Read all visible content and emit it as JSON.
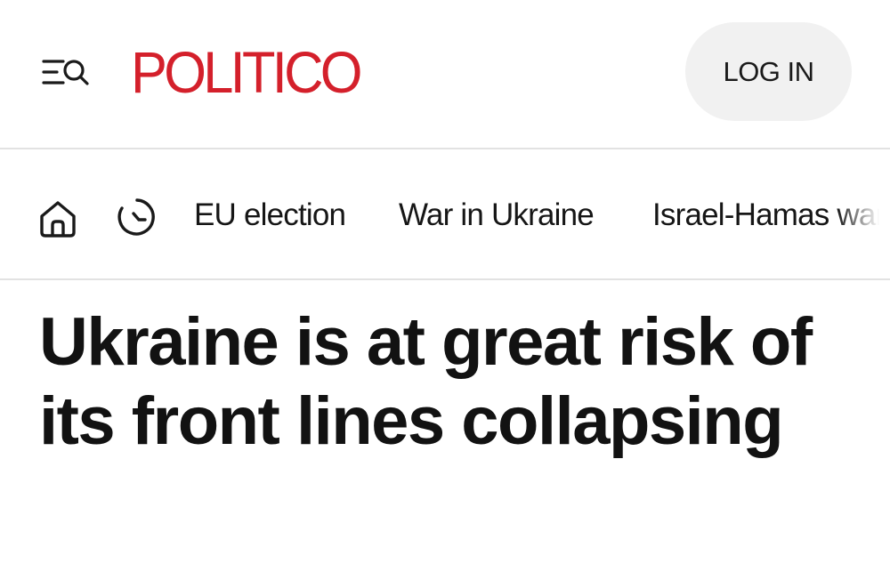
{
  "header": {
    "menu_search_icon": "menu-search-icon",
    "logo_text": "POLITICO",
    "logo_color": "#d4202b",
    "login_label": "LOG IN"
  },
  "nav": {
    "home_icon": "home-icon",
    "recent_icon": "clock-icon",
    "links": [
      {
        "label": "EU election"
      },
      {
        "label": "War in Ukraine"
      },
      {
        "label": "Israel-Hamas war"
      }
    ]
  },
  "article": {
    "headline": "Ukraine is at great risk of its front lines collapsing"
  }
}
